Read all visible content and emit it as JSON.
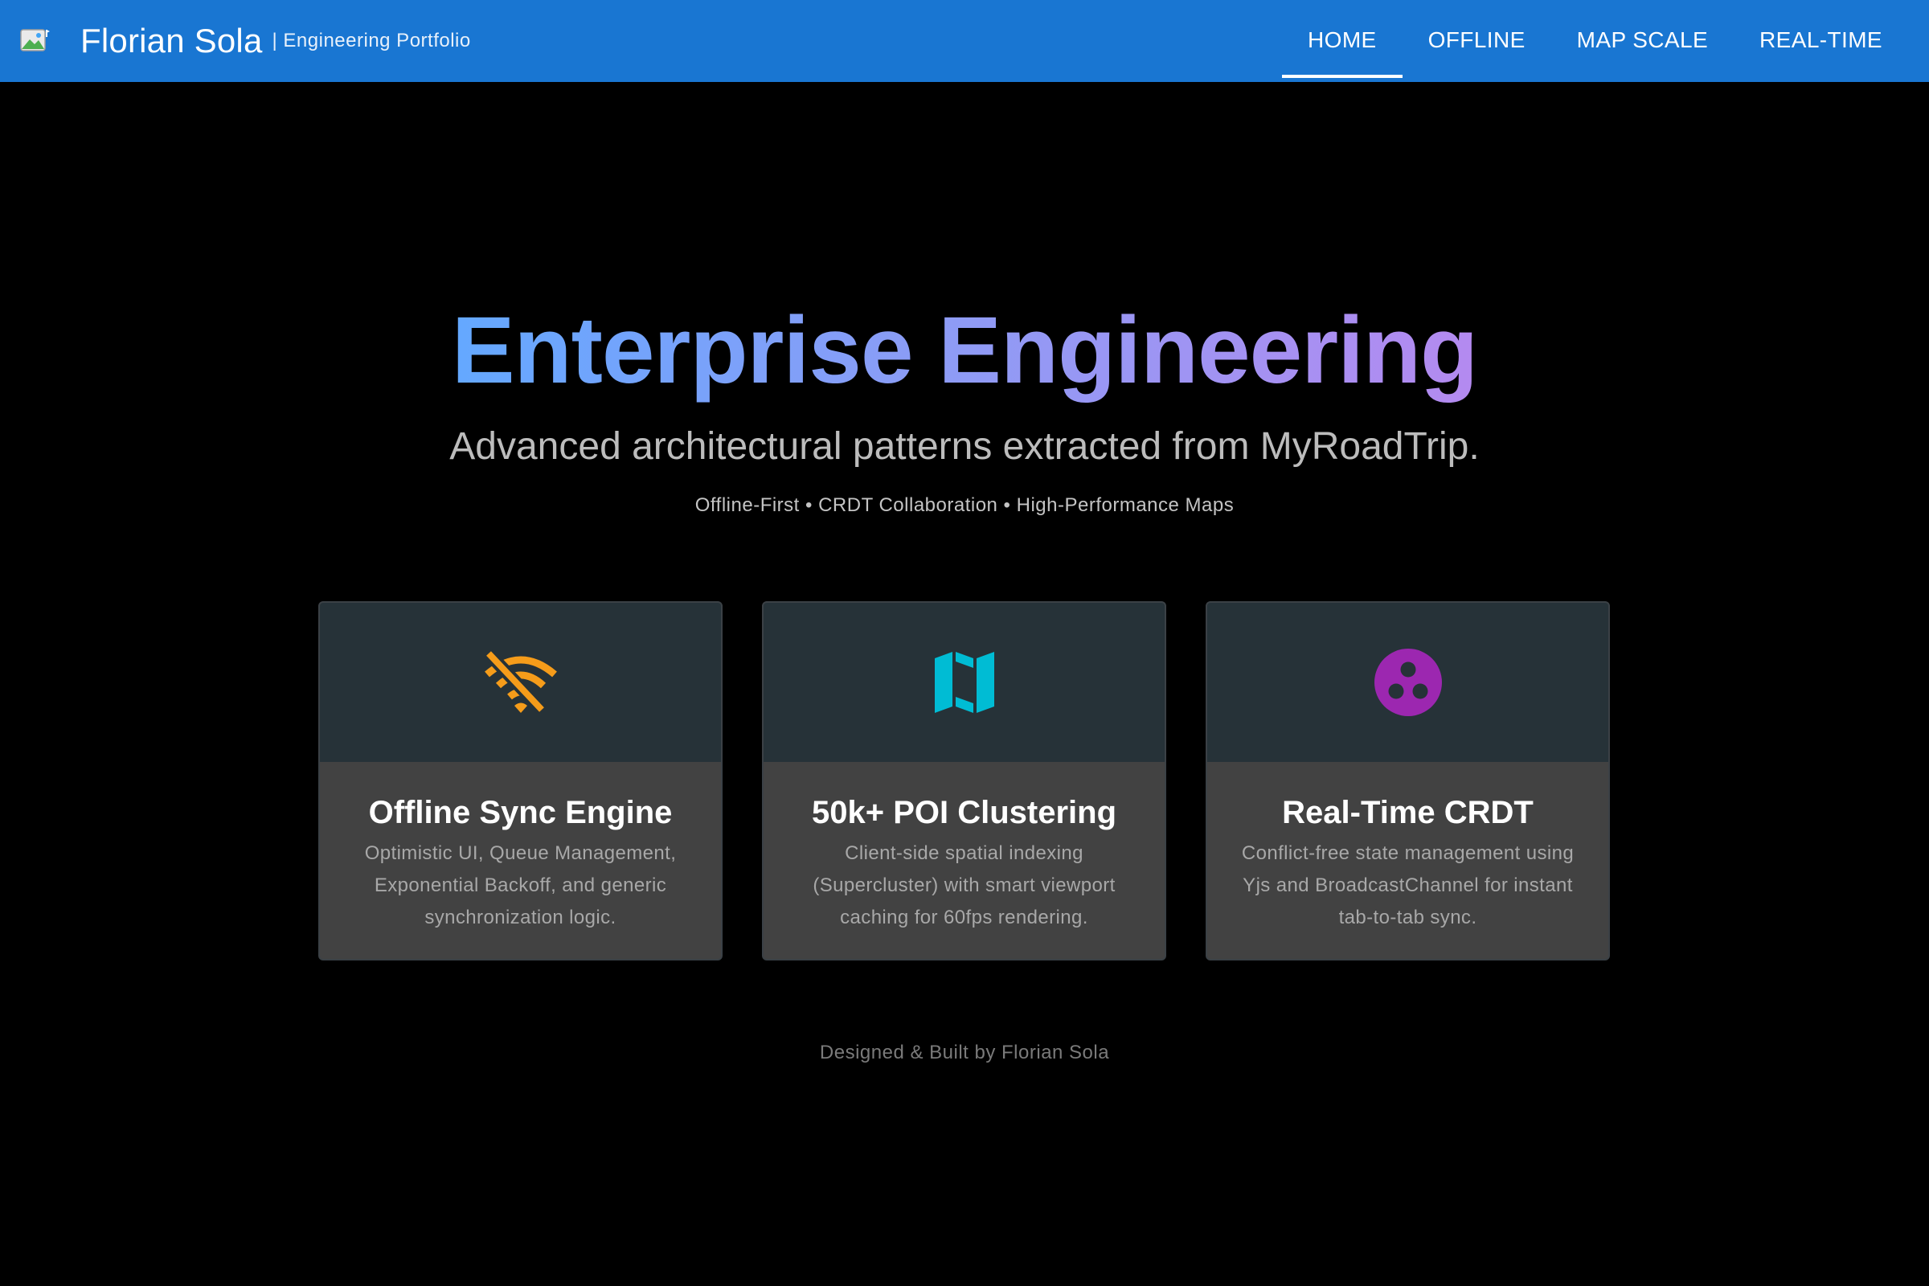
{
  "header": {
    "brand_name": "Florian Sola",
    "brand_subtitle": "| Engineering Portfolio",
    "logo_icon": "landscape-logo-icon",
    "color": "#1976d2",
    "nav": [
      {
        "label": "HOME",
        "active": true
      },
      {
        "label": "OFFLINE",
        "active": false
      },
      {
        "label": "MAP SCALE",
        "active": false
      },
      {
        "label": "REAL-TIME",
        "active": false
      }
    ]
  },
  "hero": {
    "title": "Enterprise Engineering",
    "subtitle": "Advanced architectural patterns extracted from MyRoadTrip.",
    "tags": "Offline-First • CRDT Collaboration • High-Performance Maps"
  },
  "cards": [
    {
      "icon": "wifi-off-icon",
      "icon_color": "#f59c1a",
      "title": "Offline Sync Engine",
      "text": "Optimistic UI, Queue Management, Exponential Backoff, and generic synchronization logic."
    },
    {
      "icon": "map-icon",
      "icon_color": "#00bcd4",
      "title": "50k+ POI Clustering",
      "text": "Client-side spatial indexing (Supercluster) with smart viewport caching for 60fps rendering."
    },
    {
      "icon": "workspaces-icon",
      "icon_color": "#9c27b0",
      "title": "Real-Time CRDT",
      "text": "Conflict-free state management using Yjs and BroadcastChannel for instant tab-to-tab sync."
    }
  ],
  "footer": {
    "text": "Designed & Built by Florian Sola"
  }
}
